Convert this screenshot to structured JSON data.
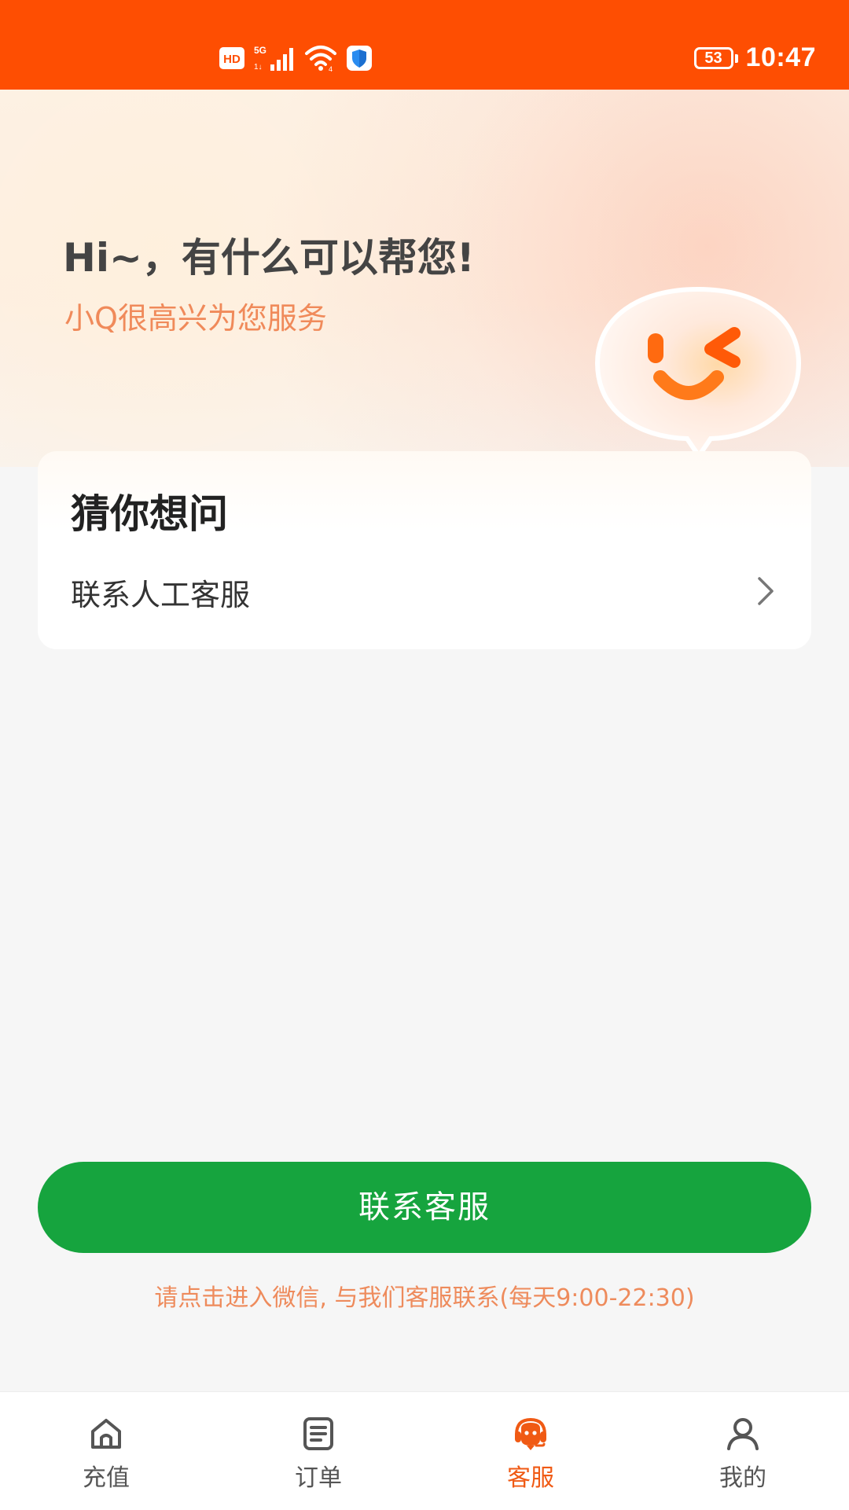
{
  "status_bar": {
    "battery": "53",
    "time": "10:47",
    "background": "#fe4e02",
    "icons": [
      "hd-icon",
      "5g-signal-icon",
      "wifi-icon",
      "shield-icon"
    ]
  },
  "hero": {
    "title": "Hi~，有什么可以帮您!",
    "subtitle": "小Q很高兴为您服务",
    "mascot_icon": "winking-chat-bubble-icon"
  },
  "faq": {
    "title": "猜你想问",
    "items": [
      {
        "label": "联系人工客服"
      }
    ]
  },
  "contact": {
    "button_label": "联系客服",
    "hint": "请点击进入微信, 与我们客服联系(每天9:00-22:30)",
    "button_color": "#16a43e"
  },
  "bottom_nav": {
    "items": [
      {
        "label": "充值",
        "icon": "home-icon",
        "active": false
      },
      {
        "label": "订单",
        "icon": "order-list-icon",
        "active": false
      },
      {
        "label": "客服",
        "icon": "customer-service-icon",
        "active": true
      },
      {
        "label": "我的",
        "icon": "user-icon",
        "active": false
      }
    ],
    "active_color": "#f05a14"
  }
}
